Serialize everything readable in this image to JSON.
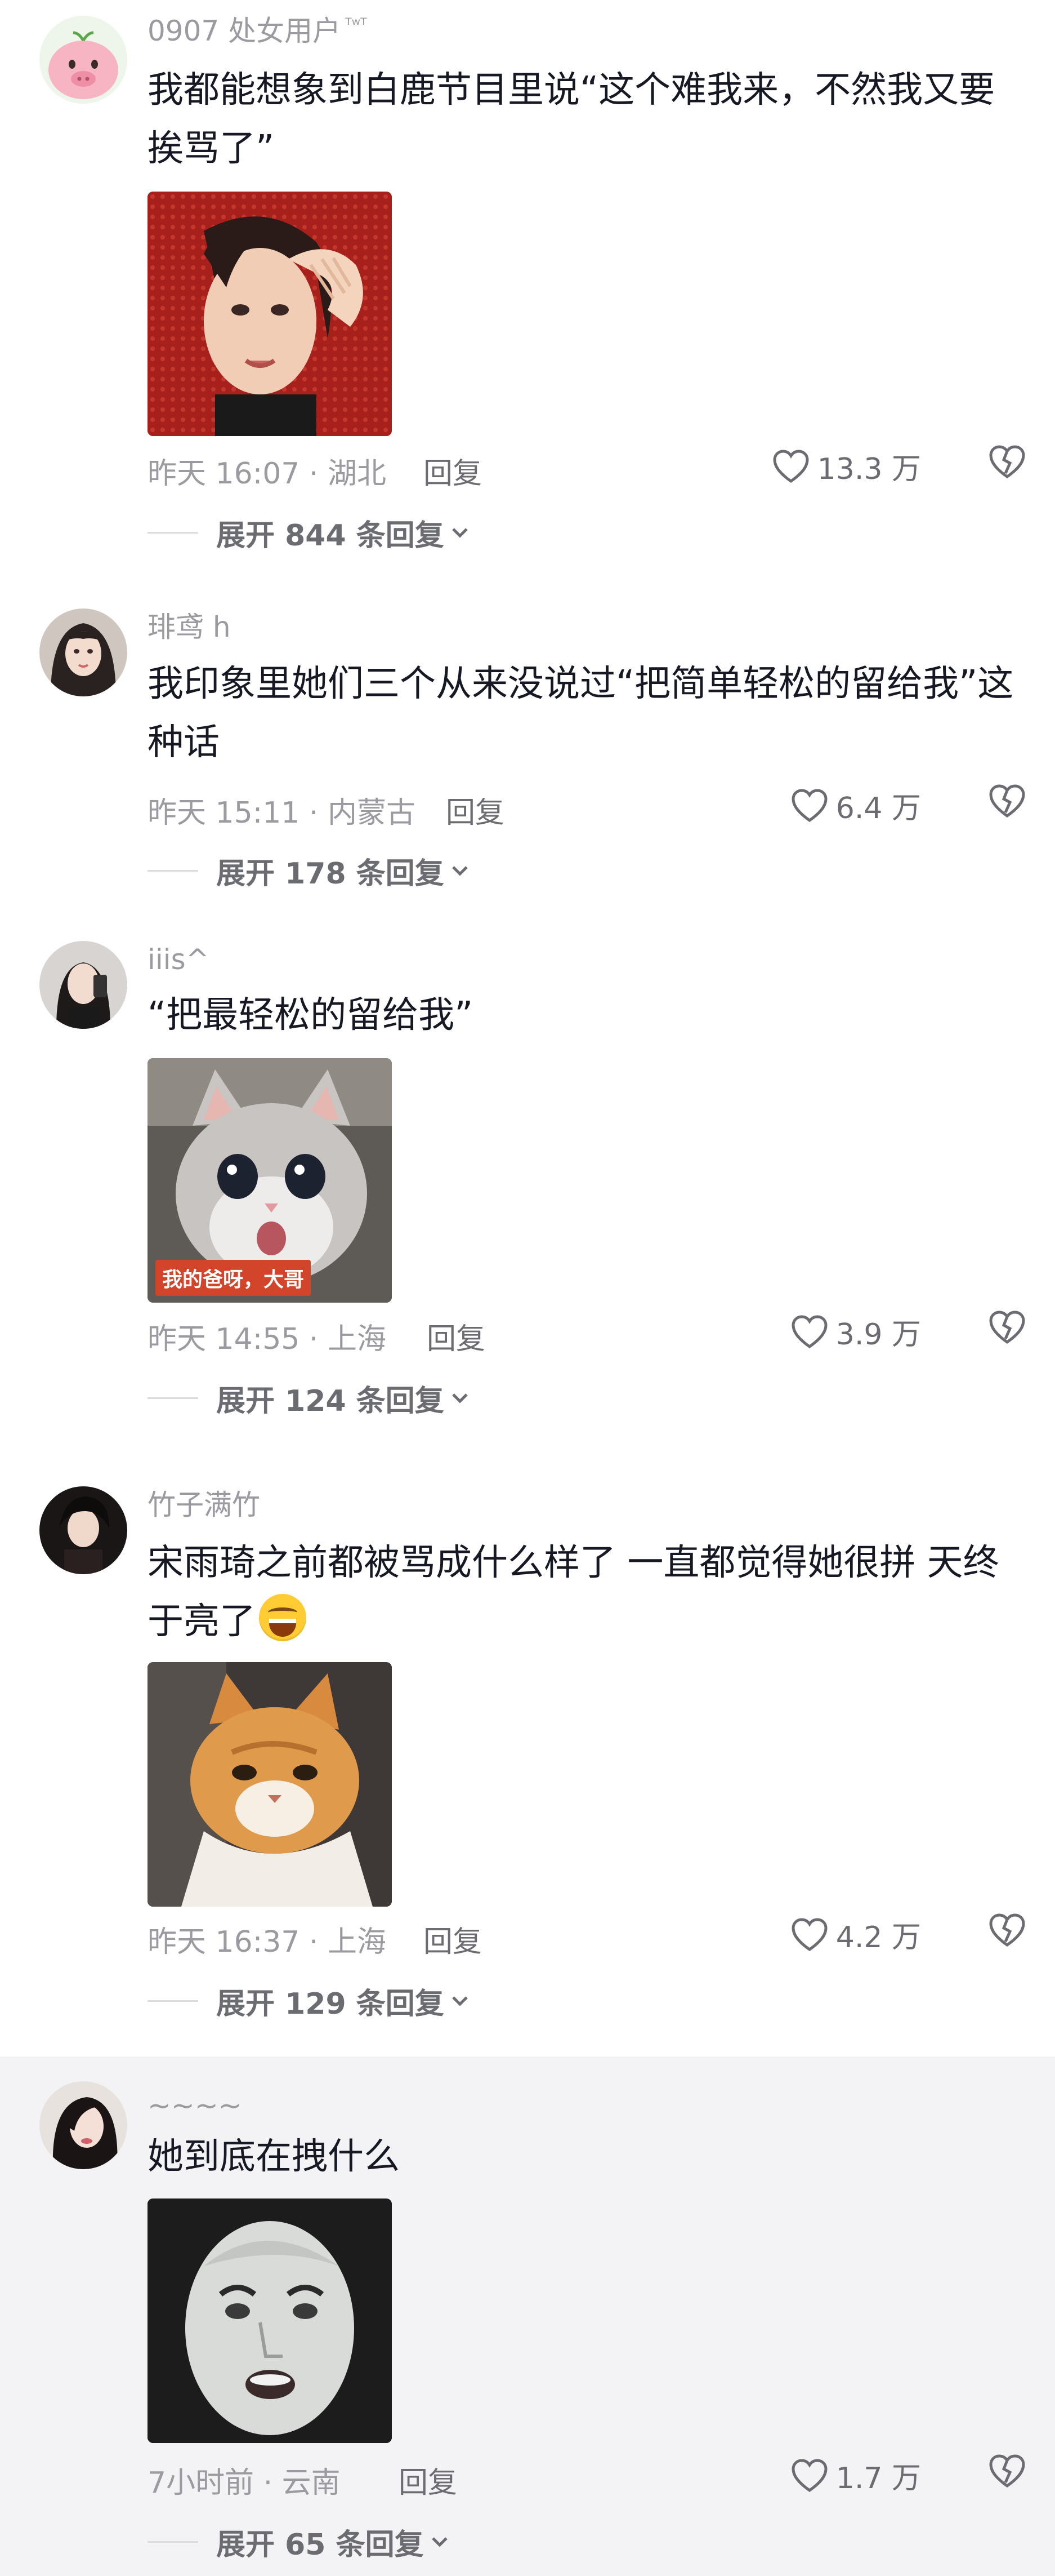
{
  "comments": [
    {
      "username": "0907 处女用户",
      "username_suffix": "ᵀʷᵀ",
      "text": "我都能想象到白鹿节目里说“这个难我来，不然我又要挨骂了”",
      "time_location": "昨天 16:07 · 湖北",
      "reply_label": "回复",
      "likes": "13.3 万",
      "expand_label": "展开 844 条回复",
      "image": "woman-touching-hair-sticker"
    },
    {
      "username": "琲鸢 h",
      "text": "我印象里她们三个从来没说过“把简单轻松的留给我”这种话",
      "time_location": "昨天 15:11 · 内蒙古",
      "reply_label": "回复",
      "likes": "6.4 万",
      "expand_label": "展开 178 条回复"
    },
    {
      "username": "iiis^",
      "text": "“把最轻松的留给我”",
      "time_location": "昨天 14:55 · 上海",
      "reply_label": "回复",
      "likes": "3.9 万",
      "expand_label": "展开 124 条回复",
      "image": "gray-kitten-sticker",
      "image_caption": "我的爸呀，大哥"
    },
    {
      "username": "竹子满竹",
      "text": "宋雨琦之前都被骂成什么样了 一直都觉得她很拼 天终于亮了",
      "emoji": "grinning-sweat-emoji",
      "time_location": "昨天 16:37 · 上海",
      "reply_label": "回复",
      "likes": "4.2 万",
      "expand_label": "展开 129 条回复",
      "image": "orange-cat-sticker"
    },
    {
      "username": "~~~~",
      "text": "她到底在拽什么",
      "time_location": "7小时前 · 云南",
      "reply_label": "回复",
      "likes": "1.7 万",
      "expand_label": "展开 65 条回复",
      "image": "white-face-sticker"
    }
  ],
  "icons": {
    "like": "heart-outline-icon",
    "dislike": "broken-heart-icon",
    "expand": "chevron-down-icon"
  },
  "colors": {
    "text": "#161823",
    "secondary": "#9a9aa0",
    "highlight_bg": "#f3f3f5"
  }
}
